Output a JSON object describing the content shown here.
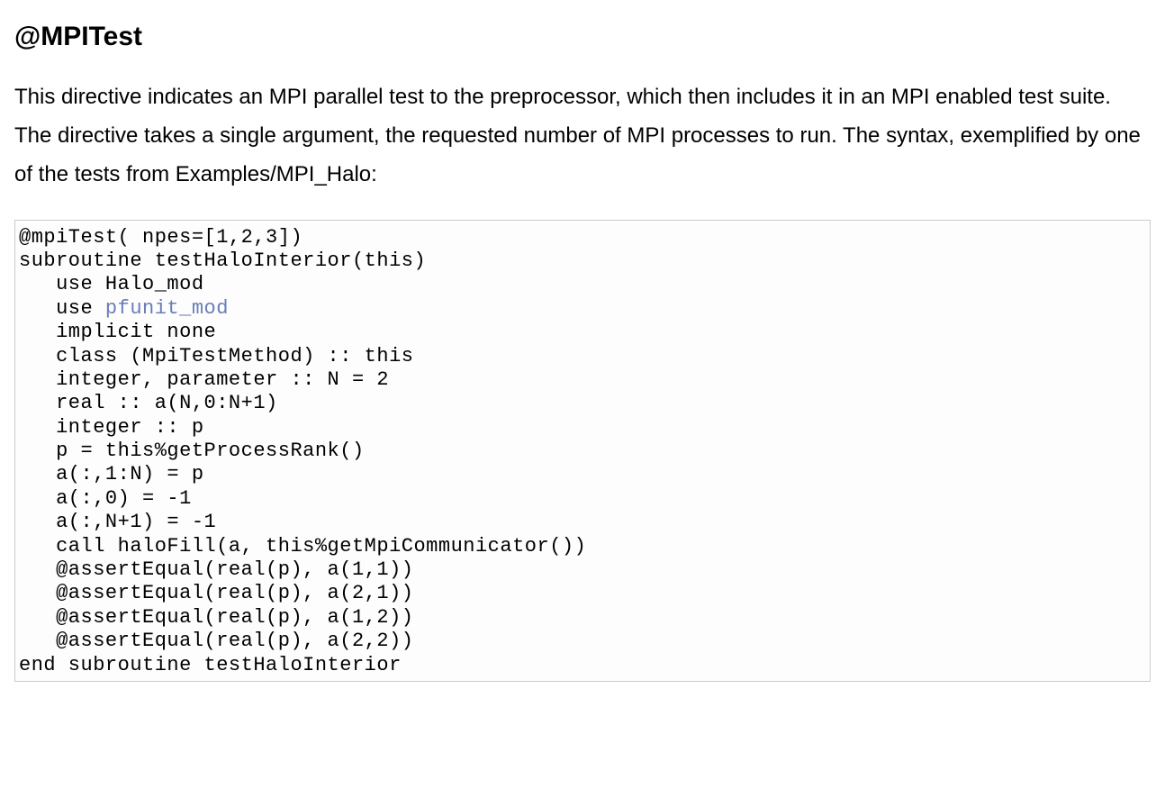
{
  "heading": "@MPITest",
  "paragraph": "This directive indicates an MPI parallel test to the preprocessor, which then includes it in an MPI enabled test suite. The directive takes a single argument, the requested number of MPI processes to run. The syntax, exemplified by one of the tests from Examples/MPI_Halo:",
  "code": {
    "line1": "@mpiTest( npes=[1,2,3])",
    "line2": "subroutine testHaloInterior(this)",
    "line3": "   use Halo_mod",
    "line4a": "   use ",
    "line4b": "pfunit_mod",
    "line5": "   implicit none",
    "line6": "   class (MpiTestMethod) :: this",
    "line7": "",
    "line8": "   integer, parameter :: N = 2",
    "line9": "   real :: a(N,0:N+1)",
    "line10": "   integer :: p",
    "line11": "",
    "line12": "   p = this%getProcessRank()",
    "line13": "   a(:,1:N) = p",
    "line14": "   a(:,0) = -1",
    "line15": "   a(:,N+1) = -1",
    "line16": "",
    "line17": "   call haloFill(a, this%getMpiCommunicator())",
    "line18": "",
    "line19": "   @assertEqual(real(p), a(1,1))",
    "line20": "   @assertEqual(real(p), a(2,1))",
    "line21": "   @assertEqual(real(p), a(1,2))",
    "line22": "   @assertEqual(real(p), a(2,2))",
    "line23": "",
    "line24": "end subroutine testHaloInterior"
  }
}
